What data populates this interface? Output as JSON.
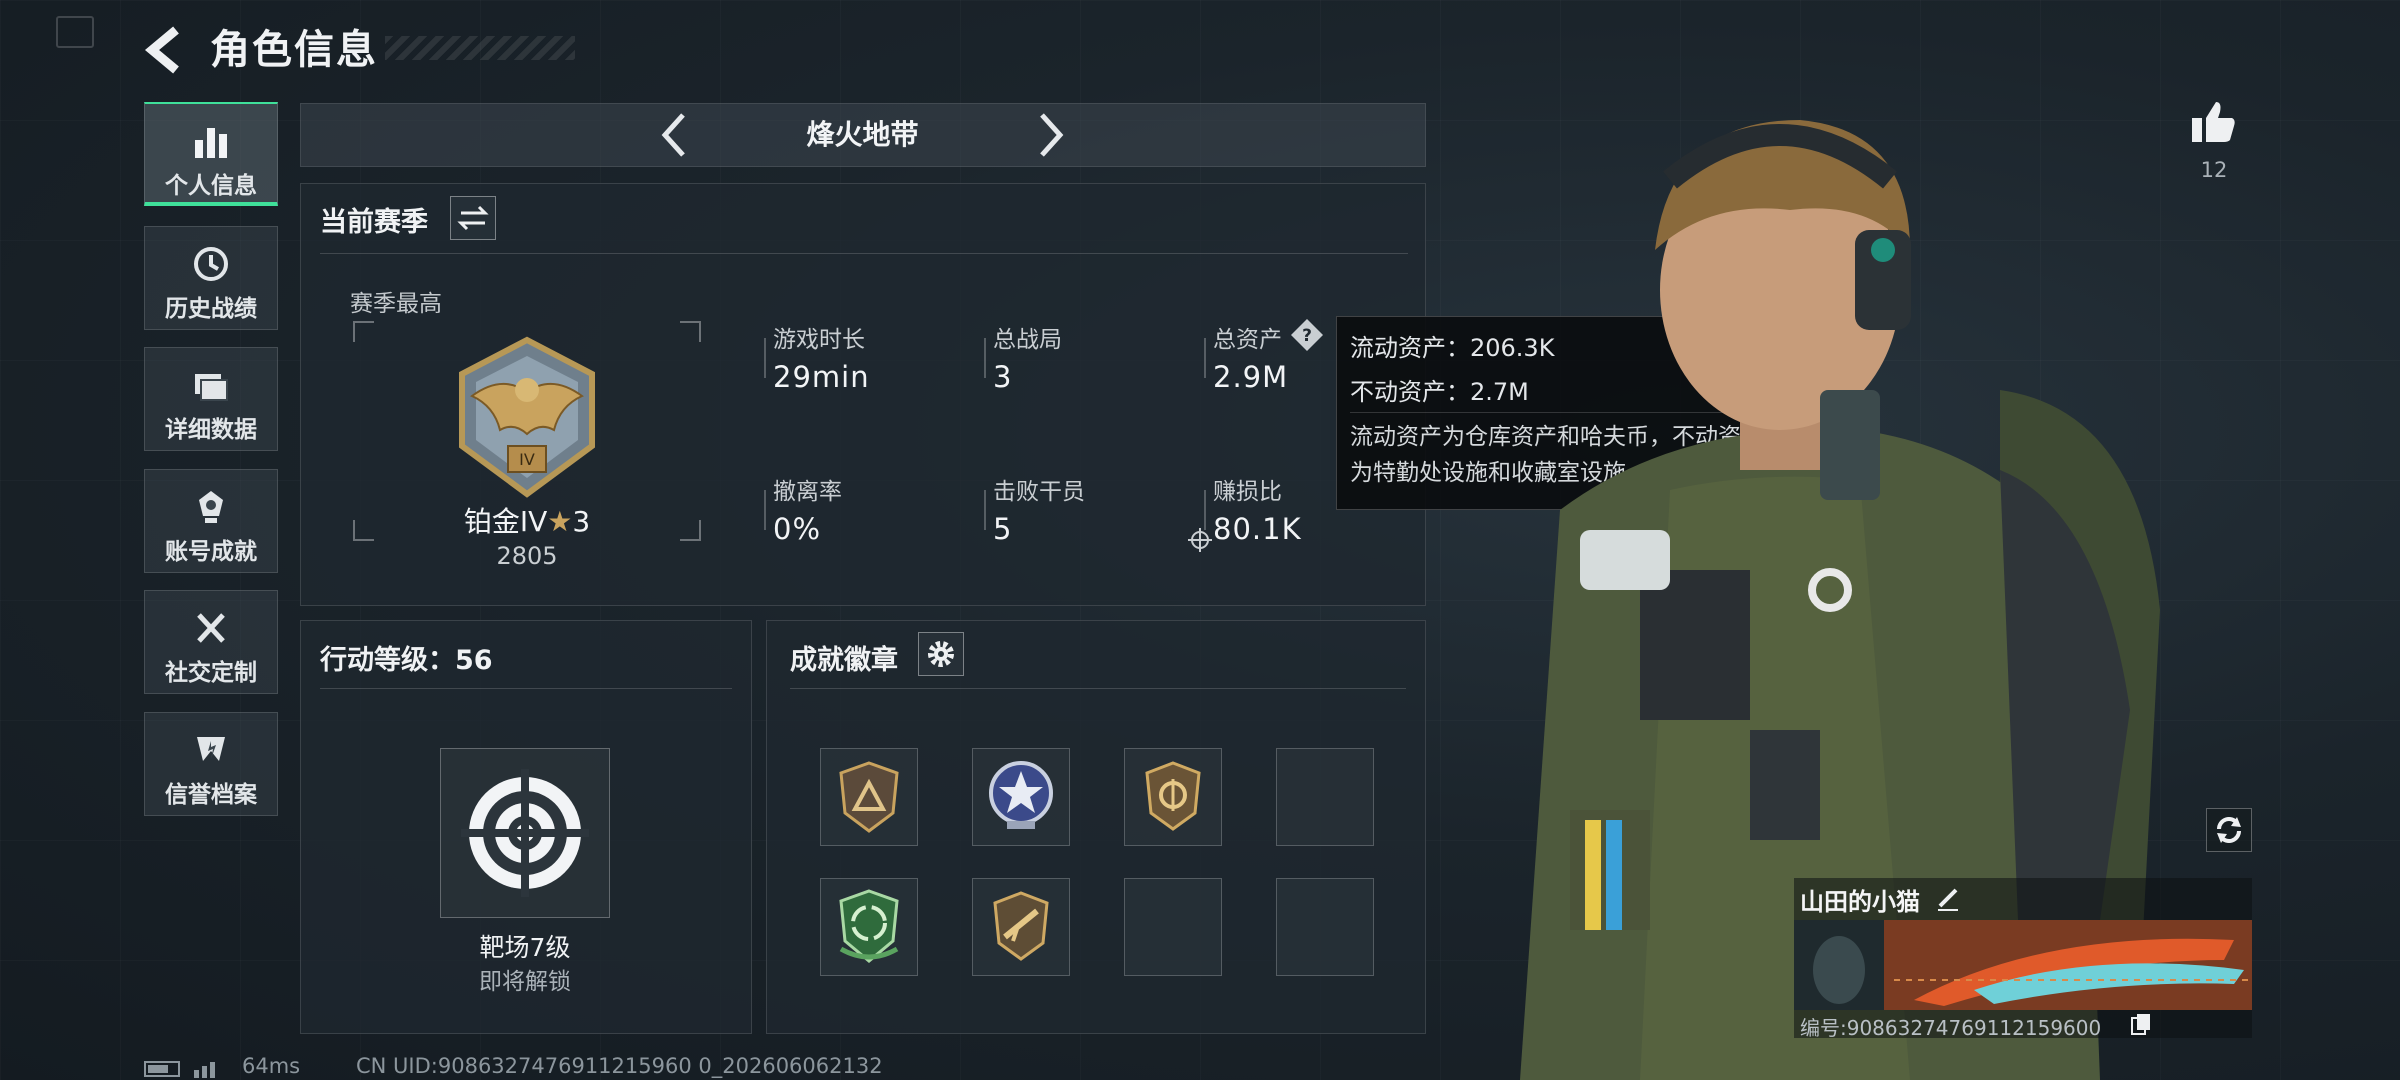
{
  "header": {
    "title": "角色信息"
  },
  "sidebar": {
    "items": [
      {
        "label": "个人信息",
        "icon": "bar-chart-icon",
        "active": true
      },
      {
        "label": "历史战绩",
        "icon": "clock-icon",
        "active": false
      },
      {
        "label": "详细数据",
        "icon": "folder-icon",
        "active": false
      },
      {
        "label": "账号成就",
        "icon": "achievement-icon",
        "active": false
      },
      {
        "label": "社交定制",
        "icon": "tools-icon",
        "active": false
      },
      {
        "label": "信誉档案",
        "icon": "reputation-icon",
        "active": false
      }
    ]
  },
  "mode": {
    "label": "烽火地带"
  },
  "season": {
    "title": "当前赛季",
    "best_label": "赛季最高",
    "rank_name": "铂金IV",
    "rank_stars": "3",
    "rank_score": "2805",
    "stats": [
      {
        "label": "游戏时长",
        "value": "29min"
      },
      {
        "label": "总战局",
        "value": "3"
      },
      {
        "label": "总资产",
        "value": "2.9M"
      },
      {
        "label": "撤离率",
        "value": "0%"
      },
      {
        "label": "击败干员",
        "value": "5"
      },
      {
        "label": "赚损比",
        "value": "80.1K"
      }
    ]
  },
  "tooltip": {
    "liquid": "流动资产：206.3K",
    "fixed": "不动资产：2.7M",
    "desc_line1": "流动资产为仓库资产和哈夫币，不动资产",
    "desc_line2": "为特勤处设施和收藏室设施"
  },
  "action_level": {
    "title": "行动等级：56",
    "item_name": "靶场7级",
    "item_status": "即将解锁"
  },
  "badges": {
    "title": "成就徽章"
  },
  "likes": {
    "count": "12"
  },
  "character": {
    "name": "山田的小猫",
    "id_label": "编号:908632747691121596​00"
  },
  "footer": {
    "ping": "64ms",
    "uid": "CN UID:9086327476911215960 0_202606062132"
  },
  "colors": {
    "accent": "#3fe09a",
    "panel": "#1f282f",
    "gold": "#c9a35e"
  }
}
